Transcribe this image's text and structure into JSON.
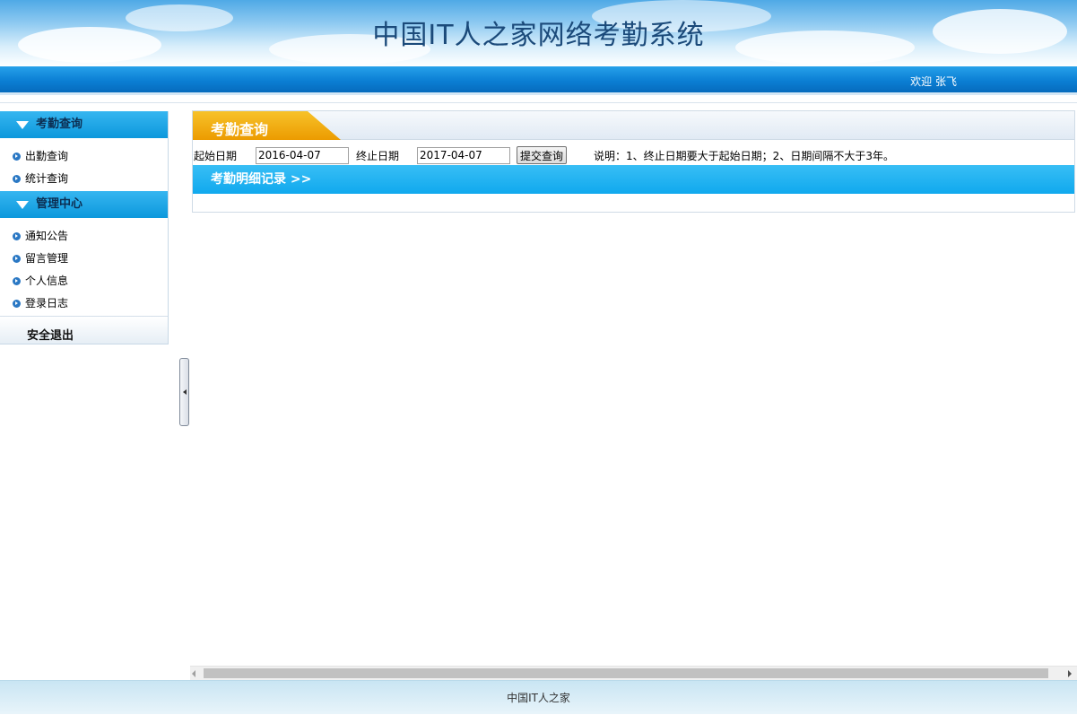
{
  "header": {
    "title": "中国IT人之家网络考勤系统",
    "welcome": "欢迎 张飞"
  },
  "sidebar": {
    "sections": [
      {
        "title": "考勤查询",
        "items": [
          "出勤查询",
          "统计查询"
        ]
      },
      {
        "title": "管理中心",
        "items": [
          "通知公告",
          "留言管理",
          "个人信息",
          "登录日志"
        ]
      }
    ],
    "logout": "安全退出"
  },
  "main": {
    "tab_title": "考勤查询",
    "start_label": "起始日期",
    "start_value": "2016-04-07",
    "end_label": "终止日期",
    "end_value": "2017-04-07",
    "submit_label": "提交查询",
    "note": "说明：1、终止日期要大于起始日期；2、日期间隔不大于3年。",
    "detail_title": "考勤明细记录 >>"
  },
  "footer": {
    "text": "中国IT人之家"
  },
  "colors": {
    "topbar": "#0b7fd4",
    "sidebar_header": "#0c98dc",
    "tab_yellow": "#f2a800",
    "detail_bar": "#10a9ee"
  }
}
